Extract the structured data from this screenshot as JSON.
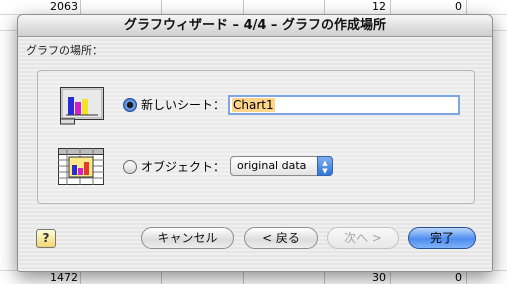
{
  "spreadsheet": {
    "top_row": [
      "2063",
      "12",
      "0"
    ],
    "bottom_row": [
      "1472",
      "30",
      "0"
    ]
  },
  "dialog": {
    "title": "グラフウィザード – 4/4 – グラフの作成場所",
    "group_label": "グラフの場所：",
    "option_new_sheet_label": "新しいシート：",
    "option_new_sheet_selected": true,
    "new_sheet_name": "Chart1",
    "option_object_label": "オブジェクト：",
    "object_sheet_value": "original data",
    "help_label": "?",
    "cancel_label": "キャンセル",
    "back_label": "< 戻る",
    "next_label": "次へ >",
    "finish_label": "完了"
  },
  "icons": {
    "new_sheet": "chart-sheet-icon",
    "object": "embedded-chart-icon",
    "stepper": "popup-arrows-icon"
  },
  "colors": {
    "accent_blue": "#4d8ef0",
    "selection_highlight": "#ffd58a",
    "field_focus_ring": "#7fa6e2"
  }
}
